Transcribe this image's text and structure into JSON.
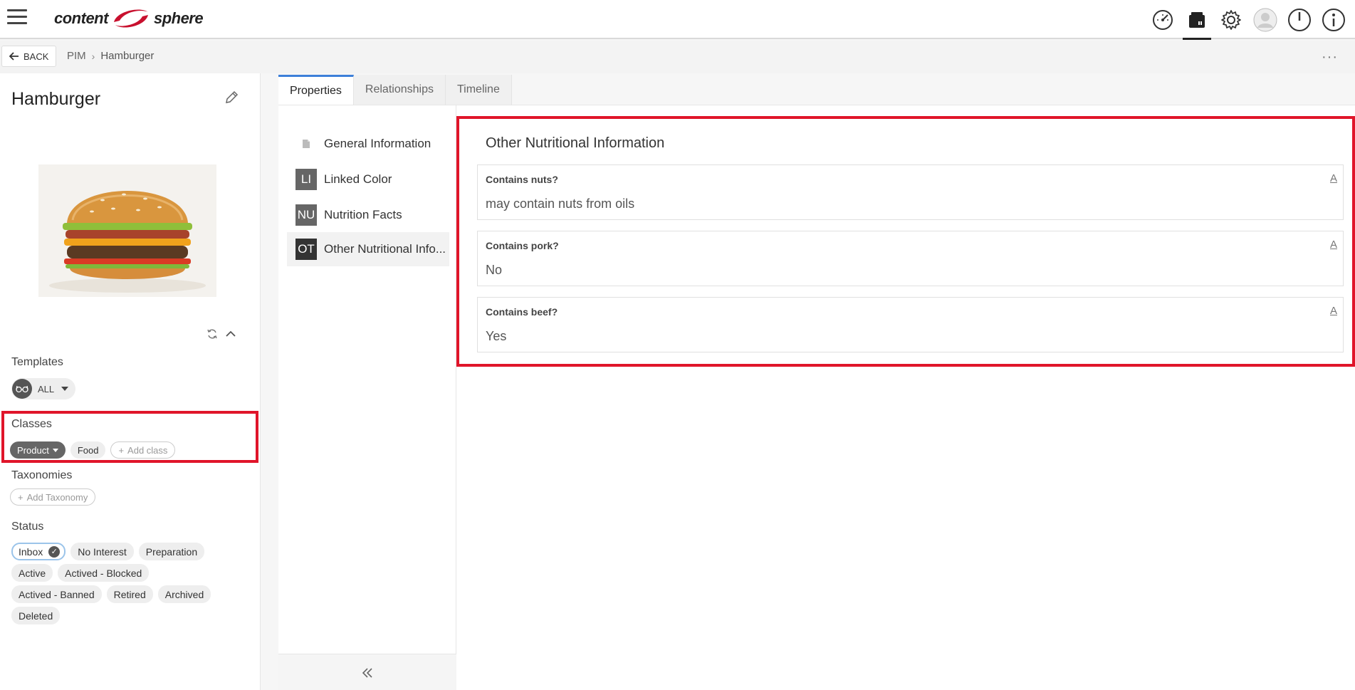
{
  "topbar": {
    "logo_left": "content",
    "logo_right": "sphere",
    "icons": [
      "dashboard-icon",
      "catalog-icon",
      "settings-icon",
      "user-icon",
      "power-icon",
      "info-icon"
    ]
  },
  "breadcrumb": {
    "back_label": "BACK",
    "items": [
      "PIM",
      "Hamburger"
    ],
    "more_label": "···"
  },
  "item": {
    "title": "Hamburger",
    "templates_label": "Templates",
    "templates_value": "ALL",
    "classes_label": "Classes",
    "classes": [
      "Product",
      "Food"
    ],
    "add_class_label": "Add class",
    "taxonomies_label": "Taxonomies",
    "add_taxonomy_label": "Add Taxonomy",
    "status_label": "Status",
    "statuses": [
      "Inbox",
      "No Interest",
      "Preparation",
      "Active",
      "Actived - Blocked",
      "Actived - Banned",
      "Retired",
      "Archived",
      "Deleted"
    ],
    "selected_status": "Inbox"
  },
  "tabs": [
    "Properties",
    "Relationships",
    "Timeline"
  ],
  "active_tab": "Properties",
  "nav": [
    {
      "badge": "",
      "label": "General Information"
    },
    {
      "badge": "LI",
      "label": "Linked Color"
    },
    {
      "badge": "NU",
      "label": "Nutrition Facts"
    },
    {
      "badge": "OT",
      "label": "Other Nutritional Info..."
    }
  ],
  "section": {
    "title": "Other Nutritional Information",
    "fields": [
      {
        "label": "Contains nuts?",
        "value": "may contain nuts from oils"
      },
      {
        "label": "Contains pork?",
        "value": "No"
      },
      {
        "label": "Contains beef?",
        "value": "Yes"
      }
    ]
  },
  "colors": {
    "highlight": "#e0152a",
    "tab_accent": "#3d7fd9",
    "logo_red": "#c8102e"
  }
}
